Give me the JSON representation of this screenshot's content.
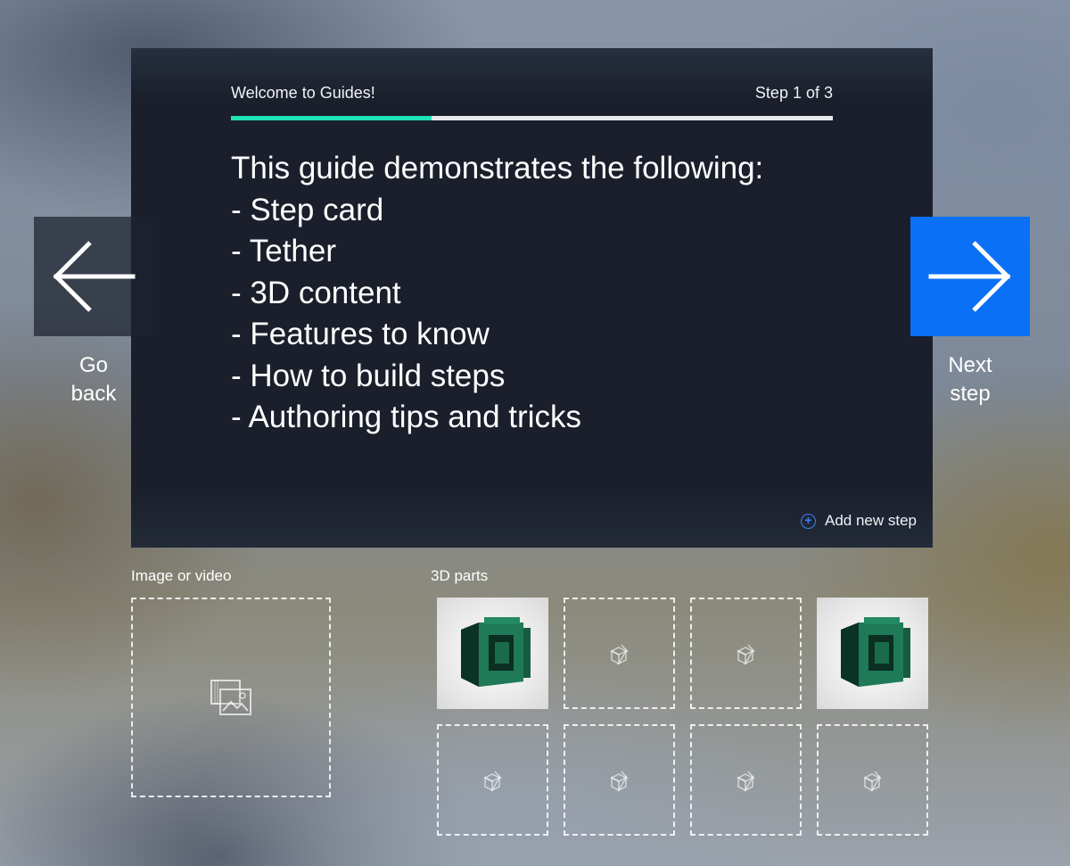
{
  "card": {
    "title": "Welcome to Guides!",
    "step_indicator": "Step 1 of 3",
    "progress_fraction": 0.333,
    "progress_color": "#1fe3b5",
    "body_lines": [
      "This guide demonstrates the following:",
      "- Step card",
      "- Tether",
      "- 3D content",
      "- Features to know",
      "- How to build steps",
      "- Authoring tips and tricks"
    ],
    "add_step_label": "Add new step"
  },
  "nav": {
    "back": {
      "line1": "Go",
      "line2": "back",
      "icon": "arrow-left-icon"
    },
    "next": {
      "line1": "Next",
      "line2": "step",
      "icon": "arrow-right-icon",
      "color": "#0a70f5"
    }
  },
  "media": {
    "image_label": "Image or video",
    "image_icon": "image-gallery-icon",
    "parts_label": "3D parts",
    "parts": [
      {
        "type": "model",
        "name": "green-bracket-part"
      },
      {
        "type": "empty",
        "icon": "cube-icon"
      },
      {
        "type": "empty",
        "icon": "cube-icon"
      },
      {
        "type": "model",
        "name": "green-bracket-part"
      },
      {
        "type": "empty",
        "icon": "cube-icon"
      },
      {
        "type": "empty",
        "icon": "cube-icon"
      },
      {
        "type": "empty",
        "icon": "cube-icon"
      },
      {
        "type": "empty",
        "icon": "cube-icon"
      }
    ]
  }
}
